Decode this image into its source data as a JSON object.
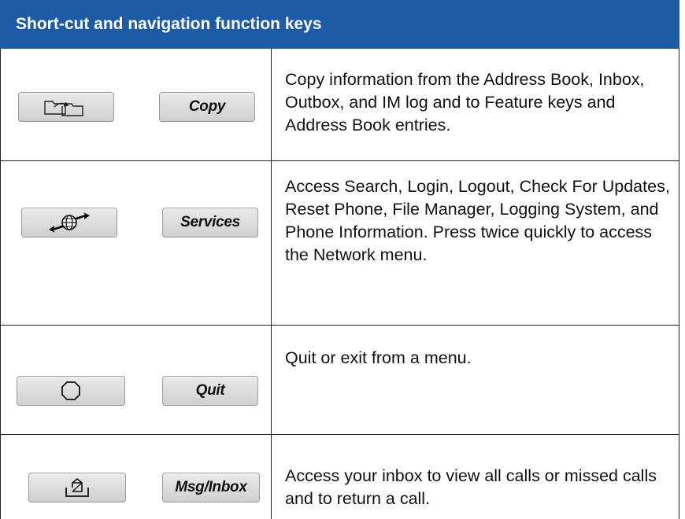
{
  "header": {
    "title": "Short-cut and navigation function keys"
  },
  "rows": [
    {
      "key_label": "Copy",
      "icon": "copy-folders-icon",
      "description": "Copy information from the Address Book, Inbox, Outbox, and IM log and to Feature keys and Address Book entries."
    },
    {
      "key_label": "Services",
      "icon": "globe-arrows-icon",
      "description": "Access Search, Login, Logout, Check For Updates, Reset Phone, File Manager, Logging System, and Phone Information. Press twice quickly to access the Network menu."
    },
    {
      "key_label": "Quit",
      "icon": "octagon-stop-icon",
      "description": "Quit or exit from a menu."
    },
    {
      "key_label": "Msg/Inbox",
      "icon": "inbox-tray-icon",
      "description": "Access your inbox to view all calls or missed calls and to return a call."
    }
  ],
  "colors": {
    "header_bg": "#1f5aa6",
    "header_text": "#ffffff",
    "border": "#222222",
    "key_bg": "#dcdcdc"
  }
}
